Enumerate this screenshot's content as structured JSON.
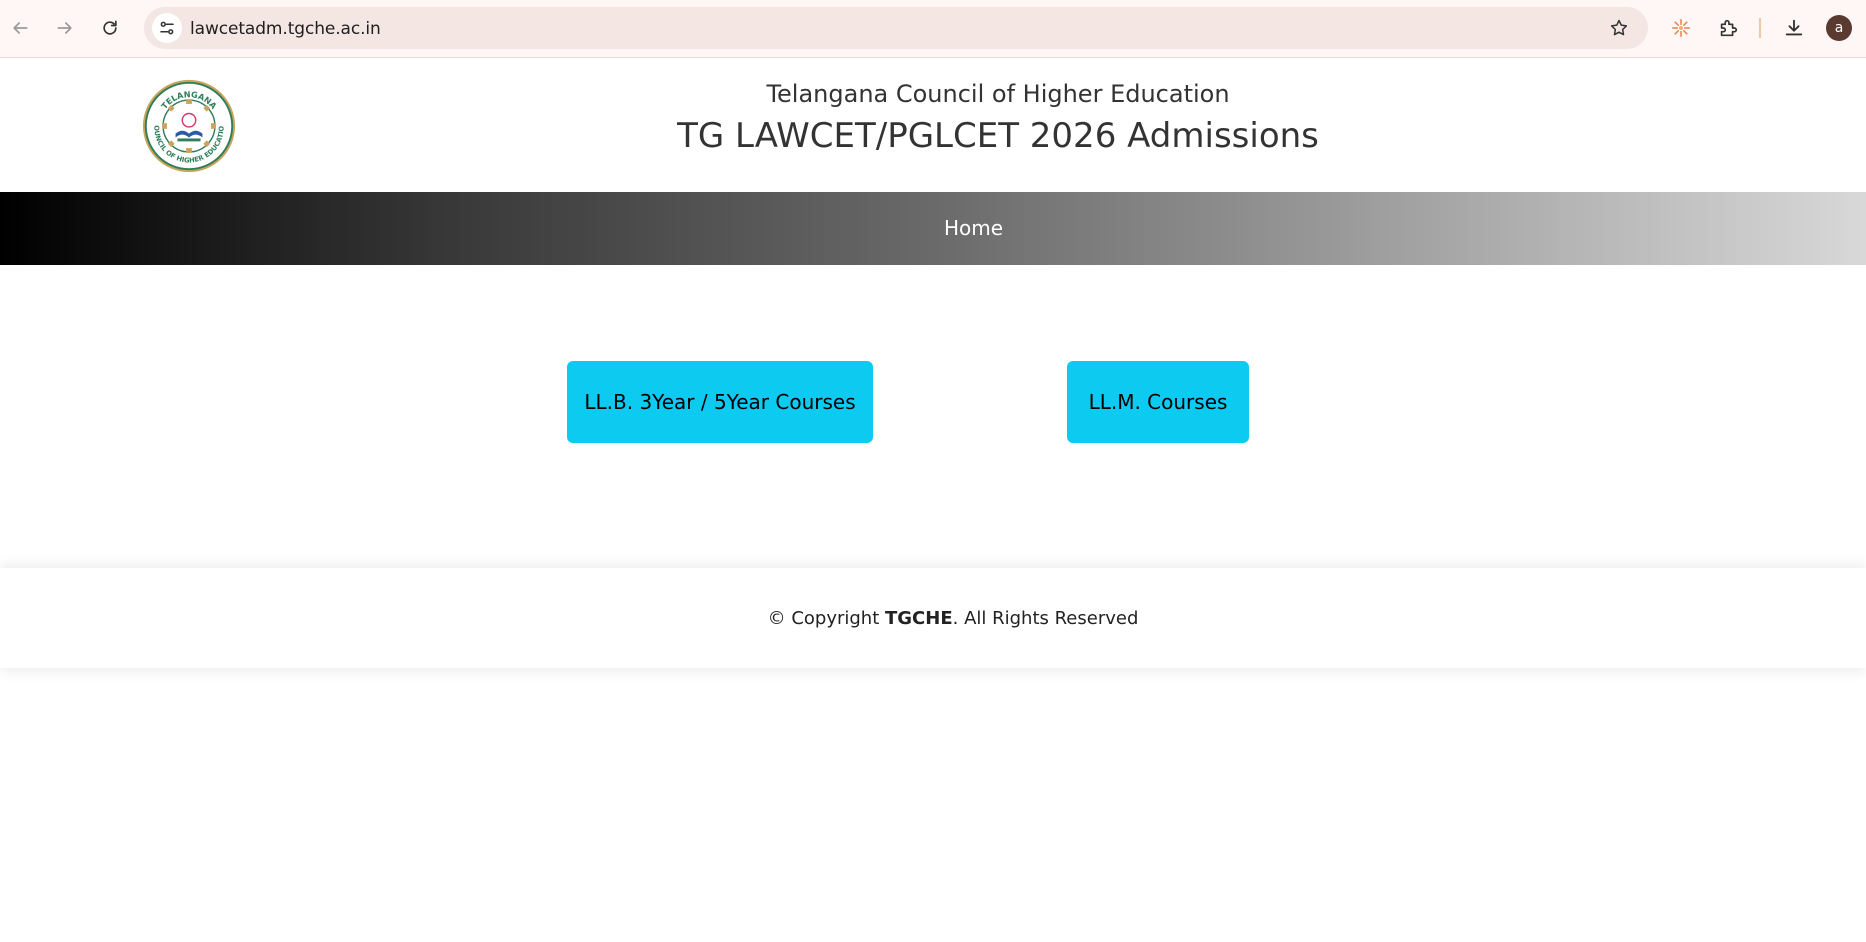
{
  "browser": {
    "url": "lawcetadm.tgche.ac.in",
    "profile_initial": "a",
    "icons": {
      "back": "back-arrow-icon",
      "forward": "forward-arrow-icon",
      "reload": "reload-icon",
      "site_info": "site-settings-icon",
      "bookmark": "star-icon",
      "extension_app": "sparkle-icon",
      "extensions": "puzzle-icon",
      "downloads": "download-icon"
    }
  },
  "header": {
    "org_name": "Telangana Council of Higher Education",
    "title": "TG LAWCET/PGLCET 2026 Admissions",
    "logo": {
      "top_text": "TELANGANA",
      "bottom_text": "COUNCIL OF HIGHER EDUCATION"
    }
  },
  "nav": {
    "home_label": "Home"
  },
  "main": {
    "llb_button": "LL.B. 3Year / 5Year Courses",
    "llm_button": "LL.M. Courses"
  },
  "footer": {
    "prefix": "© Copyright ",
    "brand": "TGCHE",
    "suffix": ". All Rights Reserved"
  },
  "colors": {
    "button_bg": "#0dcaf0",
    "toolbar_bg": "#fff7f5",
    "omnibox_bg": "#f3e6e3"
  }
}
